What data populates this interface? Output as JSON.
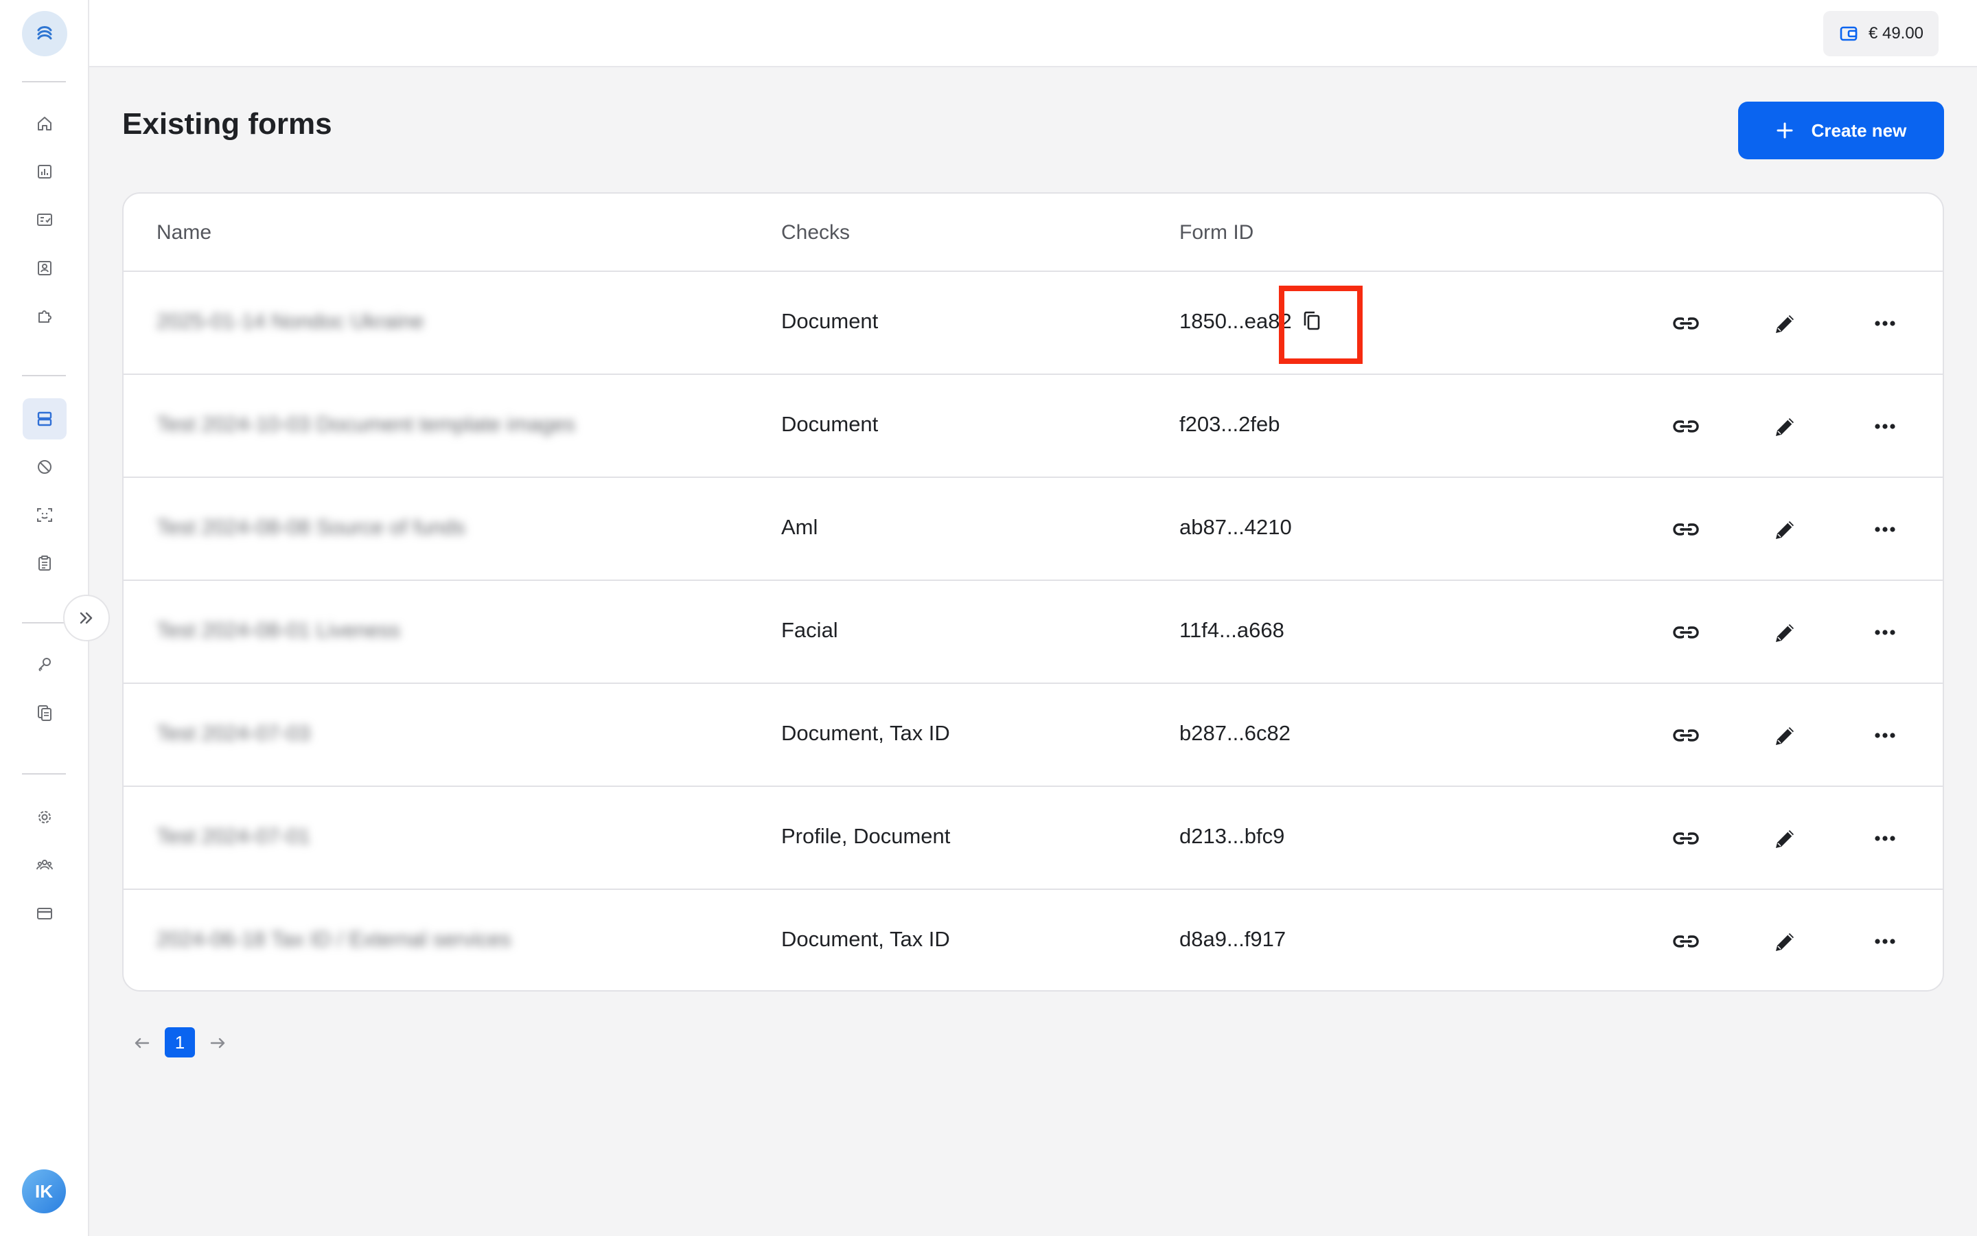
{
  "topbar": {
    "balance": "€ 49.00"
  },
  "page": {
    "title": "Existing forms",
    "create_label": "Create new"
  },
  "table": {
    "headers": {
      "name": "Name",
      "checks": "Checks",
      "form_id": "Form ID"
    },
    "rows": [
      {
        "name": "2025-01-14 Nondoc Ukraine",
        "checks": "Document",
        "form_id": "1850...ea82"
      },
      {
        "name": "Test 2024-10-03 Document template images",
        "checks": "Document",
        "form_id": "f203...2feb"
      },
      {
        "name": "Test 2024-08-08 Source of funds",
        "checks": "Aml",
        "form_id": "ab87...4210"
      },
      {
        "name": "Test 2024-08-01 Liveness",
        "checks": "Facial",
        "form_id": "11f4...a668"
      },
      {
        "name": "Test 2024-07-03",
        "checks": "Document, Tax ID",
        "form_id": "b287...6c82"
      },
      {
        "name": "Test 2024-07-01",
        "checks": "Profile, Document",
        "form_id": "d213...bfc9"
      },
      {
        "name": "2024-06-18 Tax ID / External services",
        "checks": "Document, Tax ID",
        "form_id": "d8a9...f917"
      }
    ]
  },
  "pagination": {
    "current": "1"
  },
  "user": {
    "initials": "IK"
  },
  "colors": {
    "accent": "#0a64f0",
    "highlight": "#f62b10"
  },
  "icons": [
    "home-icon",
    "analytics-icon",
    "checklist-icon",
    "contacts-icon",
    "puzzle-icon",
    "forms-icon",
    "block-icon",
    "face-scan-icon",
    "clipboard-icon",
    "key-icon",
    "documents-icon",
    "settings-icon",
    "team-icon",
    "billing-icon",
    "wallet-icon",
    "plus-icon",
    "copy-icon",
    "link-icon",
    "edit-icon",
    "more-icon"
  ]
}
